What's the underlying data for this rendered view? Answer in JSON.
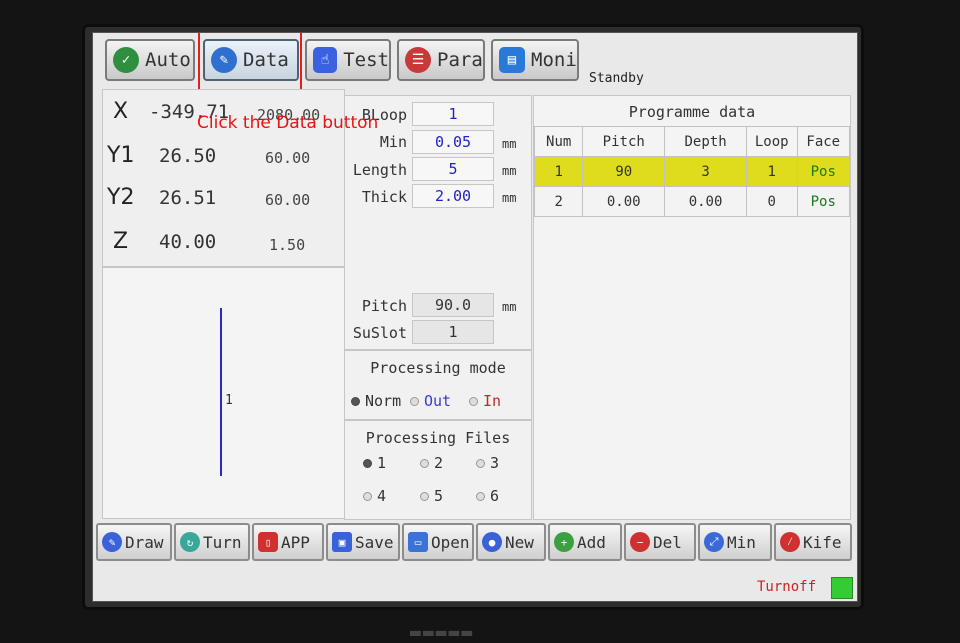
{
  "tabs": [
    {
      "label": "Auto",
      "icon": "refresh-check-icon",
      "color": "#2f8f3f"
    },
    {
      "label": "Data",
      "icon": "pencil-icon",
      "color": "#2e6fd0"
    },
    {
      "label": "Test",
      "icon": "hand-pointer-icon",
      "color": "#3a62e0"
    },
    {
      "label": "Para",
      "icon": "sliders-icon",
      "color": "#c83a3a"
    },
    {
      "label": "Moni",
      "icon": "monitor-icon",
      "color": "#2a78d8"
    }
  ],
  "status": "Standby",
  "annotation": "Click the Data button",
  "axes": [
    {
      "name": "X",
      "value": "-349.71",
      "setpoint": "2080.00"
    },
    {
      "name": "Y1",
      "value": "26.50",
      "setpoint": "60.00"
    },
    {
      "name": "Y2",
      "value": "26.51",
      "setpoint": "60.00"
    },
    {
      "name": "Z",
      "value": "40.00",
      "setpoint": "1.50"
    }
  ],
  "preview": {
    "label": "1"
  },
  "params": {
    "bloop": {
      "label": "BLoop",
      "value": "1"
    },
    "min": {
      "label": "Min",
      "value": "0.05",
      "unit": "mm"
    },
    "length": {
      "label": "Length",
      "value": "5",
      "unit": "mm"
    },
    "thick": {
      "label": "Thick",
      "value": "2.00",
      "unit": "mm"
    },
    "pitch": {
      "label": "Pitch",
      "value": "90.0",
      "unit": "mm"
    },
    "suslot": {
      "label": "SuSlot",
      "value": "1"
    }
  },
  "processing_mode": {
    "title": "Processing mode",
    "options": [
      {
        "label": "Norm",
        "color": "#333333",
        "selected": true
      },
      {
        "label": "Out",
        "color": "#3a3ad0",
        "selected": false
      },
      {
        "label": "In",
        "color": "#cc2222",
        "selected": false
      }
    ]
  },
  "processing_files": {
    "title": "Processing Files",
    "options": [
      {
        "label": "1",
        "selected": true
      },
      {
        "label": "2",
        "selected": false
      },
      {
        "label": "3",
        "selected": false
      },
      {
        "label": "4",
        "selected": false
      },
      {
        "label": "5",
        "selected": false
      },
      {
        "label": "6",
        "selected": false
      }
    ]
  },
  "programme": {
    "title": "Programme data",
    "headers": [
      "Num",
      "Pitch",
      "Depth",
      "Loop",
      "Face"
    ],
    "rows": [
      [
        "1",
        "90",
        "3",
        "1",
        "Pos"
      ],
      [
        "2",
        "0.00",
        "0.00",
        "0",
        "Pos"
      ]
    ],
    "selected_row": 0
  },
  "buttons": [
    {
      "label": "Draw",
      "icon": "draw-icon",
      "color": "#3a62d8"
    },
    {
      "label": "Turn",
      "icon": "turn-icon",
      "color": "#38a89a"
    },
    {
      "label": "APP",
      "icon": "app-icon",
      "color": "#d03030"
    },
    {
      "label": "Save",
      "icon": "save-icon",
      "color": "#3a62d8"
    },
    {
      "label": "Open",
      "icon": "folder-icon",
      "color": "#3a72d8"
    },
    {
      "label": "New",
      "icon": "new-icon",
      "color": "#3a62d8"
    },
    {
      "label": "Add",
      "icon": "plus-icon",
      "color": "#3aa040"
    },
    {
      "label": "Del",
      "icon": "minus-icon",
      "color": "#d03030"
    },
    {
      "label": "Min",
      "icon": "min-icon",
      "color": "#3a6ad8"
    },
    {
      "label": "Kife",
      "icon": "knife-icon",
      "color": "#d03030"
    }
  ],
  "footer": {
    "turnoff": "Turnoff",
    "led_color": "#33cc33"
  }
}
